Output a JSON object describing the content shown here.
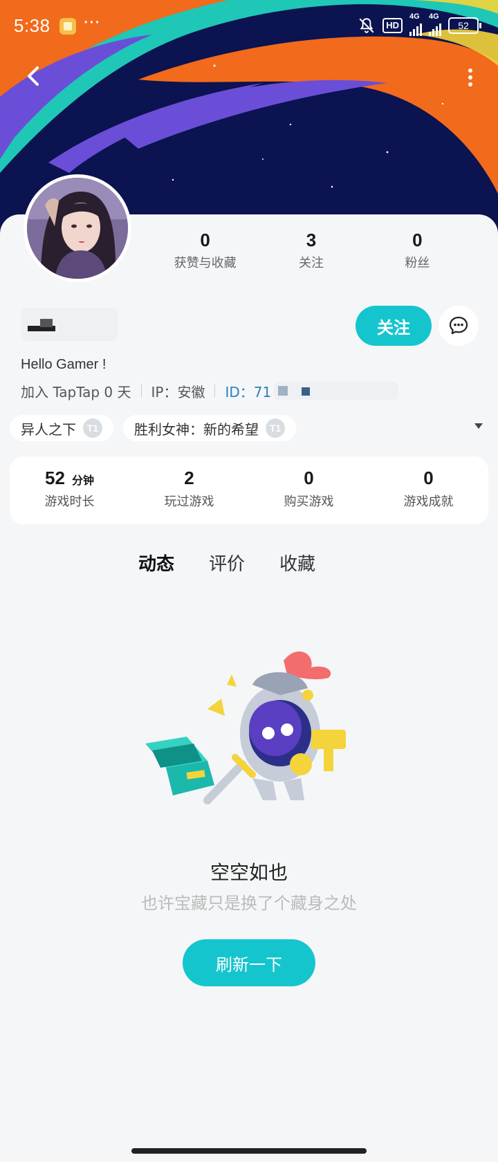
{
  "status_bar": {
    "time": "5:38",
    "dots": "···",
    "hd_badge": "HD",
    "network_1": "4G",
    "network_2": "4G",
    "battery": "52"
  },
  "header": {
    "back_icon": "chevron-left-icon",
    "more_icon": "more-vertical-icon"
  },
  "profile": {
    "stats": [
      {
        "value": "0",
        "label": "获赞与收藏"
      },
      {
        "value": "3",
        "label": "关注"
      },
      {
        "value": "0",
        "label": "粉丝"
      }
    ],
    "follow_label": "关注",
    "bio": "Hello Gamer !",
    "joined": "加入 TapTap 0 天",
    "ip": "IP：安徽",
    "id_prefix": "ID：71"
  },
  "game_chips": [
    {
      "name": "异人之下",
      "badge": "T1"
    },
    {
      "name": "胜利女神：新的希望",
      "badge": "T1"
    }
  ],
  "game_stats": [
    {
      "value": "52",
      "unit": "分钟",
      "label": "游戏时长"
    },
    {
      "value": "2",
      "unit": "",
      "label": "玩过游戏"
    },
    {
      "value": "0",
      "unit": "",
      "label": "购买游戏"
    },
    {
      "value": "0",
      "unit": "",
      "label": "游戏成就"
    }
  ],
  "tabs": [
    {
      "label": "动态",
      "active": true
    },
    {
      "label": "评价",
      "active": false
    },
    {
      "label": "收藏",
      "active": false
    }
  ],
  "empty_state": {
    "title": "空空如也",
    "subtitle": "也许宝藏只是换了个藏身之处",
    "refresh_label": "刷新一下"
  },
  "colors": {
    "accent": "#15c5ce",
    "banner_bg": "#0b1350",
    "banner_orange": "#f26a1b",
    "banner_teal": "#1fc7b6",
    "banner_purple": "#6a4ed8"
  }
}
